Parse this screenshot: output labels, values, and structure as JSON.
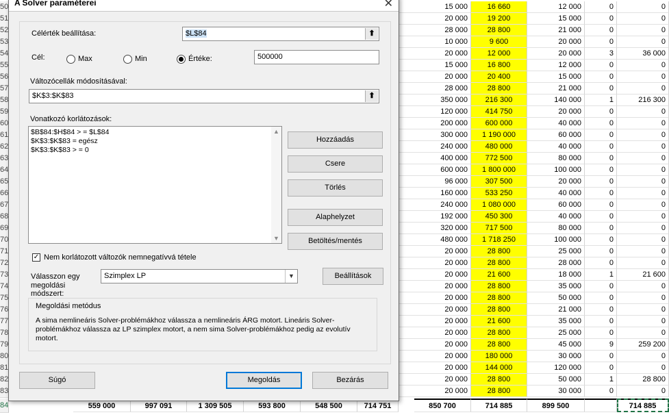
{
  "sheet": {
    "rows": [
      {
        "n": "50",
        "a": "15 000",
        "b": "16 660",
        "c": "12 000",
        "d": "0",
        "e": "0"
      },
      {
        "n": "51",
        "a": "20 000",
        "b": "19 200",
        "c": "15 000",
        "d": "0",
        "e": "0"
      },
      {
        "n": "52",
        "a": "28 000",
        "b": "28 800",
        "c": "21 000",
        "d": "0",
        "e": "0"
      },
      {
        "n": "53",
        "a": "10 000",
        "b": "9 600",
        "c": "20 000",
        "d": "0",
        "e": "0"
      },
      {
        "n": "54",
        "a": "20 000",
        "b": "12 000",
        "c": "20 000",
        "d": "3",
        "e": "36 000"
      },
      {
        "n": "55",
        "a": "15 000",
        "b": "16 800",
        "c": "12 000",
        "d": "0",
        "e": "0"
      },
      {
        "n": "56",
        "a": "20 000",
        "b": "20 400",
        "c": "15 000",
        "d": "0",
        "e": "0"
      },
      {
        "n": "57",
        "a": "28 000",
        "b": "28 800",
        "c": "21 000",
        "d": "0",
        "e": "0"
      },
      {
        "n": "58",
        "a": "350 000",
        "b": "216 300",
        "c": "140 000",
        "d": "1",
        "e": "216 300"
      },
      {
        "n": "59",
        "a": "120 000",
        "b": "414 750",
        "c": "20 000",
        "d": "0",
        "e": "0"
      },
      {
        "n": "60",
        "a": "200 000",
        "b": "600 000",
        "c": "40 000",
        "d": "0",
        "e": "0"
      },
      {
        "n": "61",
        "a": "300 000",
        "b": "1 190 000",
        "c": "60 000",
        "d": "0",
        "e": "0"
      },
      {
        "n": "62",
        "a": "240 000",
        "b": "480 000",
        "c": "40 000",
        "d": "0",
        "e": "0"
      },
      {
        "n": "63",
        "a": "400 000",
        "b": "772 500",
        "c": "80 000",
        "d": "0",
        "e": "0"
      },
      {
        "n": "64",
        "a": "600 000",
        "b": "1 800 000",
        "c": "100 000",
        "d": "0",
        "e": "0"
      },
      {
        "n": "65",
        "a": "96 000",
        "b": "307 500",
        "c": "20 000",
        "d": "0",
        "e": "0"
      },
      {
        "n": "66",
        "a": "160 000",
        "b": "533 250",
        "c": "40 000",
        "d": "0",
        "e": "0"
      },
      {
        "n": "67",
        "a": "240 000",
        "b": "1 080 000",
        "c": "60 000",
        "d": "0",
        "e": "0"
      },
      {
        "n": "68",
        "a": "192 000",
        "b": "450 300",
        "c": "40 000",
        "d": "0",
        "e": "0"
      },
      {
        "n": "69",
        "a": "320 000",
        "b": "717 500",
        "c": "80 000",
        "d": "0",
        "e": "0"
      },
      {
        "n": "70",
        "a": "480 000",
        "b": "1 718 250",
        "c": "100 000",
        "d": "0",
        "e": "0"
      },
      {
        "n": "71",
        "a": "20 000",
        "b": "28 800",
        "c": "25 000",
        "d": "0",
        "e": "0"
      },
      {
        "n": "72",
        "a": "20 000",
        "b": "28 800",
        "c": "28 000",
        "d": "0",
        "e": "0"
      },
      {
        "n": "73",
        "a": "20 000",
        "b": "21 600",
        "c": "18 000",
        "d": "1",
        "e": "21 600"
      },
      {
        "n": "74",
        "a": "20 000",
        "b": "28 800",
        "c": "35 000",
        "d": "0",
        "e": "0"
      },
      {
        "n": "75",
        "a": "20 000",
        "b": "28 800",
        "c": "50 000",
        "d": "0",
        "e": "0"
      },
      {
        "n": "76",
        "a": "20 000",
        "b": "28 800",
        "c": "21 000",
        "d": "0",
        "e": "0"
      },
      {
        "n": "77",
        "a": "20 000",
        "b": "21 600",
        "c": "35 000",
        "d": "0",
        "e": "0"
      },
      {
        "n": "78",
        "a": "20 000",
        "b": "28 800",
        "c": "25 000",
        "d": "0",
        "e": "0"
      },
      {
        "n": "79",
        "a": "20 000",
        "b": "28 800",
        "c": "45 000",
        "d": "9",
        "e": "259 200"
      },
      {
        "n": "80",
        "a": "20 000",
        "b": "180 000",
        "c": "30 000",
        "d": "0",
        "e": "0"
      },
      {
        "n": "81",
        "a": "20 000",
        "b": "144 000",
        "c": "120 000",
        "d": "0",
        "e": "0"
      },
      {
        "n": "82",
        "a": "20 000",
        "b": "28 800",
        "c": "50 000",
        "d": "1",
        "e": "28 800"
      },
      {
        "n": "83",
        "a": "20 000",
        "b": "28 800",
        "c": "30 000",
        "d": "0",
        "e": "0"
      }
    ],
    "total": {
      "n": "84",
      "cells": [
        "559 000",
        "997 091",
        "1 309 505",
        "593 800",
        "548 500",
        "714 751",
        "850 700",
        "714 885",
        "899 500",
        "",
        "714 885"
      ]
    },
    "yellow": "#ffff00"
  },
  "dialog": {
    "title": "A Solver paraméterei",
    "close_glyph": "✕",
    "objective_label": "Célérték beállítása:",
    "objective_value": "$L$84",
    "goal_label": "Cél:",
    "radio_max": "Max",
    "radio_min": "Min",
    "radio_value": "Értéke:",
    "goal_value": "500000",
    "changing_label": "Változócellák módosításával:",
    "changing_value": "$K$3:$K$83",
    "constraints_label": "Vonatkozó korlátozások:",
    "constraints": [
      "$B$84:$H$84 > = $L$84",
      "$K$3:$K$83 = egész",
      "$K$3:$K$83 > = 0"
    ],
    "btn_add": "Hozzáadás",
    "btn_change": "Csere",
    "btn_delete": "Törlés",
    "btn_reset": "Alaphelyzet",
    "btn_load": "Betöltés/mentés",
    "nonneg_label": "Nem korlátozott változók nemnegatívvá tétele",
    "method_label": "Válasszon egy megoldási módszert:",
    "method_value": "Szimplex LP",
    "btn_options": "Beállítások",
    "group_title": "Megoldási metódus",
    "group_text": "A sima nemlineáris Solver-problémákhoz válassza a nemlineáris ÁRG motort. Lineáris Solver-problémákhoz válassza az LP szimplex motort, a nem sima Solver-problémákhoz pedig az evolutív motort.",
    "btn_help": "Súgó",
    "btn_solve": "Megoldás",
    "btn_close": "Bezárás",
    "upload_glyph": "⬆",
    "accent": "#0078d7"
  }
}
